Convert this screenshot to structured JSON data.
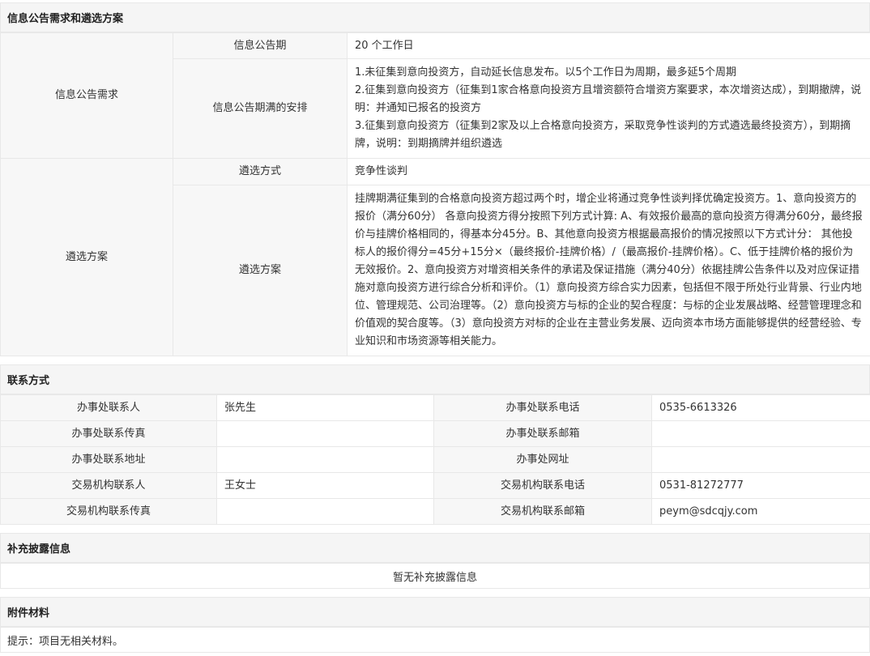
{
  "disclosure": {
    "section_title": "信息公告需求和遴选方案",
    "req_label": "信息公告需求",
    "period_label": "信息公告期",
    "period_value": "20 个工作日",
    "expiry_label": "信息公告期满的安排",
    "expiry_lines": [
      "1.未征集到意向投资方，自动延长信息发布。以5个工作日为周期，最多延5个周期",
      "2.征集到意向投资方（征集到1家合格意向投资方且增资额符合增资方案要求，本次增资达成），到期撤牌，说明：并通知已报名的投资方",
      "3.征集到意向投资方（征集到2家及以上合格意向投资方，采取竞争性谈判的方式遴选最终投资方），到期摘牌，说明：到期摘牌并组织遴选"
    ],
    "plan_label": "遴选方案",
    "method_label": "遴选方式",
    "method_value": "竞争性谈判",
    "scheme_label": "遴选方案",
    "scheme_text": "挂牌期满征集到的合格意向投资方超过两个时，增企业将通过竞争性谈判择优确定投资方。1、意向投资方的报价（满分60分） 各意向投资方得分按照下列方式计算: A、有效报价最高的意向投资方得满分60分，最终报价与挂牌价格相同的，得基本分45分。B、其他意向投资方根据最高报价的情况按照以下方式计分： 其他投标人的报价得分=45分+15分×（最终报价-挂牌价格）/（最高报价-挂牌价格）。C、低于挂牌价格的报价为无效报价。2、意向投资方对增资相关条件的承诺及保证措施（满分40分）依据挂牌公告条件以及对应保证措施对意向投资方进行综合分析和评价。（1）意向投资方综合实力因素，包括但不限于所处行业背景、行业内地位、管理规范、公司治理等。（2）意向投资方与标的企业的契合程度：与标的企业发展战略、经营管理理念和价值观的契合度等。（3）意向投资方对标的企业在主营业务发展、迈向资本市场方面能够提供的经营经验、专业知识和市场资源等相关能力。"
  },
  "contact": {
    "section_title": "联系方式",
    "rows": [
      {
        "l1": "办事处联系人",
        "v1": "张先生",
        "l2": "办事处联系电话",
        "v2": "0535-6613326"
      },
      {
        "l1": "办事处联系传真",
        "v1": "",
        "l2": "办事处联系邮箱",
        "v2": ""
      },
      {
        "l1": "办事处联系地址",
        "v1": "",
        "l2": "办事处网址",
        "v2": ""
      },
      {
        "l1": "交易机构联系人",
        "v1": "王女士",
        "l2": "交易机构联系电话",
        "v2": "0531-81272777"
      },
      {
        "l1": "交易机构联系传真",
        "v1": "",
        "l2": "交易机构联系邮箱",
        "v2": "peym@sdcqjy.com"
      }
    ]
  },
  "supplement": {
    "section_title": "补充披露信息",
    "text": "暂无补充披露信息"
  },
  "attachments": {
    "section_title": "附件材料",
    "text": "提示：项目无相关材料。"
  }
}
